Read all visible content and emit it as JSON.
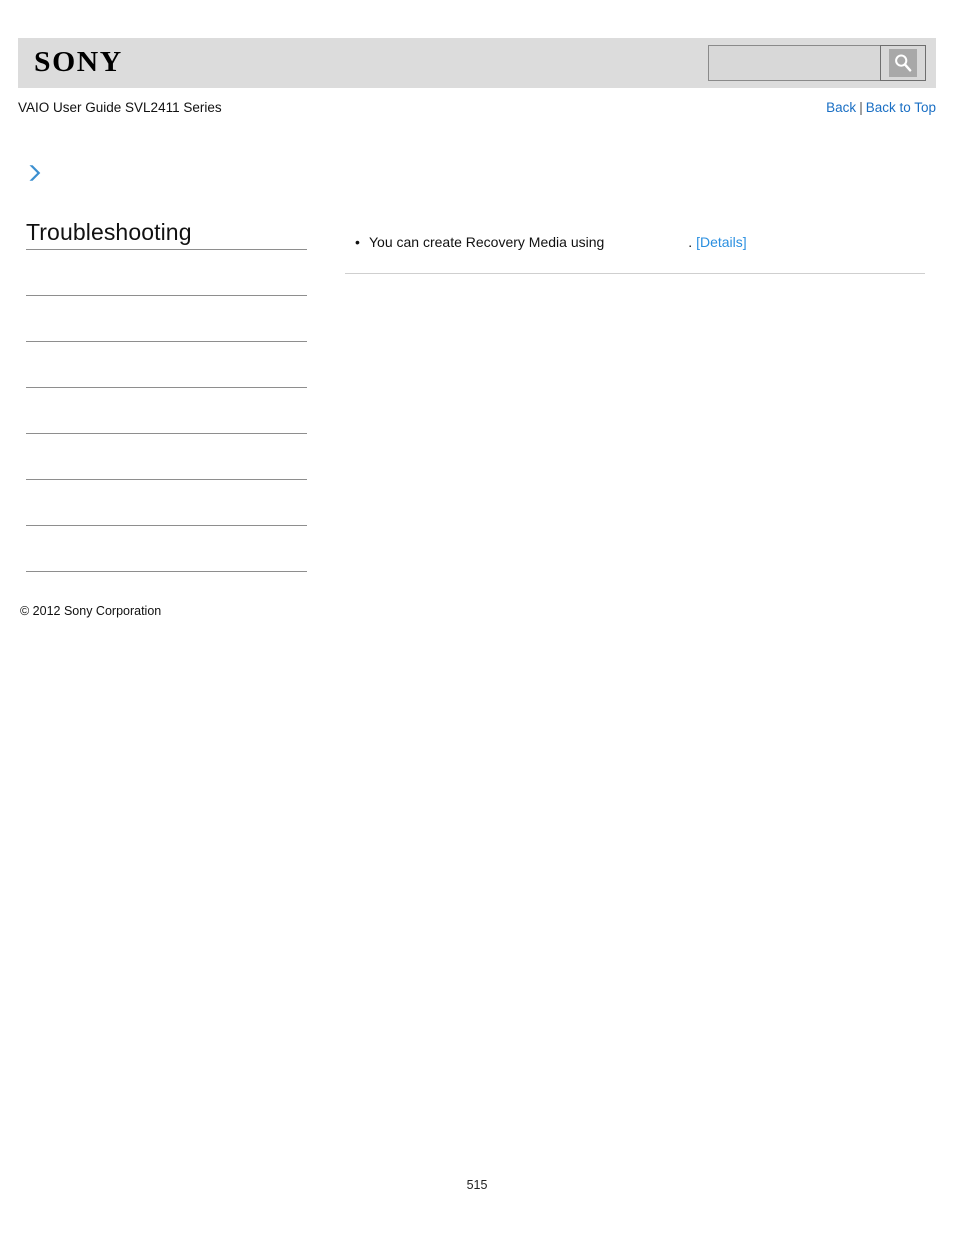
{
  "header": {
    "logo_text": "SONY",
    "search": {
      "value": "",
      "placeholder": "",
      "icon": "search-icon",
      "button_label": ""
    }
  },
  "sub_header": {
    "guide_title": "VAIO User Guide SVL2411 Series",
    "nav": {
      "back_label": "Back",
      "separator": "|",
      "back_to_top_label": "Back to Top"
    }
  },
  "breadcrumb": {
    "icon": "chevron-right-icon",
    "text": ""
  },
  "sidebar": {
    "heading": "Troubleshooting",
    "items": [
      {
        "label": ""
      },
      {
        "label": ""
      },
      {
        "label": ""
      },
      {
        "label": ""
      },
      {
        "label": ""
      },
      {
        "label": ""
      },
      {
        "label": ""
      }
    ]
  },
  "main": {
    "bullets": [
      {
        "bullet": "•",
        "text": "You can create Recovery Media using",
        "period": ".",
        "link_label": "[Details]"
      }
    ]
  },
  "footer": {
    "copyright": "© 2012 Sony Corporation",
    "page_number": "515"
  },
  "colors": {
    "header_bg": "#dcdcdc",
    "link_blue": "#1a6fc4",
    "details_blue": "#2a8fe0",
    "chevron_blue": "#3b8fd0",
    "rule_gray": "#8e8e8e",
    "content_rule_gray": "#cfcfcf"
  }
}
